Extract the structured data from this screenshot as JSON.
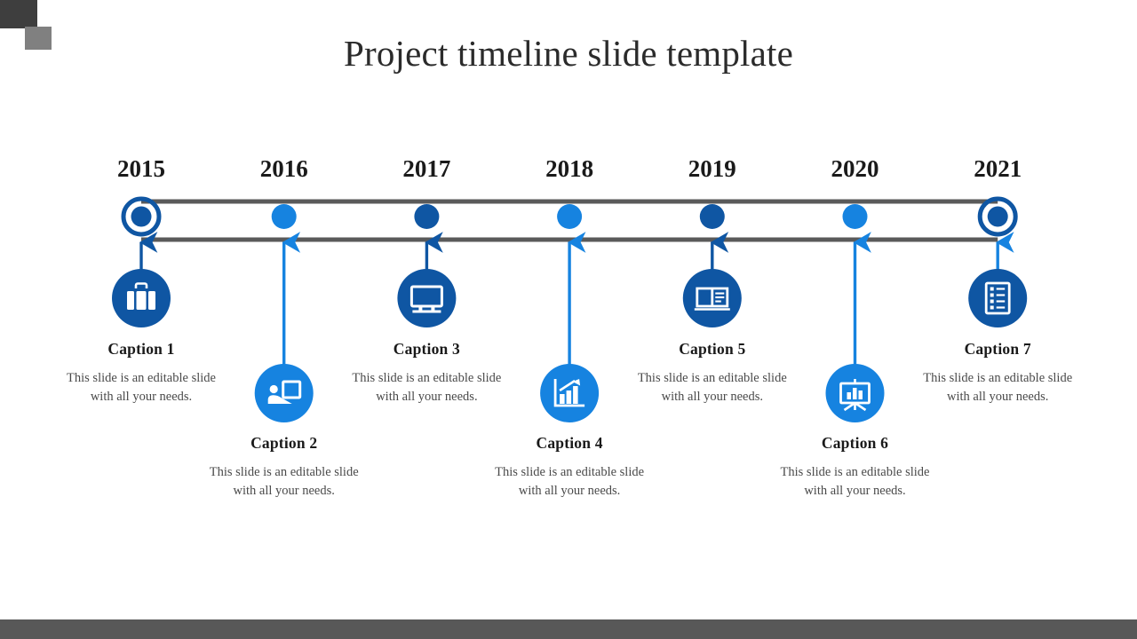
{
  "slide": {
    "title": "Project timeline slide template",
    "background_color": "#ffffff",
    "footer_color": "#585858",
    "corner_square_dark_color": "#3e3e3e",
    "corner_square_mid_color": "#808080"
  },
  "palette": {
    "dark_blue": "#0f56a3",
    "light_blue": "#1683e0",
    "rail_gray": "#5a5a5a",
    "title_color": "#2b2b2b",
    "caption_title_color": "#1a1a1a",
    "caption_body_color": "#4a4a4a"
  },
  "timeline": {
    "rail_style": "double-horizontal-line",
    "milestones": [
      {
        "year": "2015",
        "marker_style": "ring",
        "marker_color": "#0f56a3",
        "icon": "briefcase-icon",
        "icon_circle_color": "#0f56a3",
        "connector_color": "#0f56a3",
        "row": "upper",
        "caption_title": "Caption 1",
        "caption_body": "This slide is an editable slide with all your needs."
      },
      {
        "year": "2016",
        "marker_style": "solid",
        "marker_color": "#1683e0",
        "icon": "presenter-board-icon",
        "icon_circle_color": "#1683e0",
        "connector_color": "#1683e0",
        "row": "lower",
        "caption_title": "Caption 2",
        "caption_body": "This slide is an editable slide with all your needs."
      },
      {
        "year": "2017",
        "marker_style": "solid",
        "marker_color": "#0f56a3",
        "icon": "monitor-icon",
        "icon_circle_color": "#0f56a3",
        "connector_color": "#0f56a3",
        "row": "upper",
        "caption_title": "Caption 3",
        "caption_body": "This slide is an editable slide with all your needs."
      },
      {
        "year": "2018",
        "marker_style": "solid",
        "marker_color": "#1683e0",
        "icon": "bar-chart-growth-icon",
        "icon_circle_color": "#1683e0",
        "connector_color": "#1683e0",
        "row": "lower",
        "caption_title": "Caption 4",
        "caption_body": "This slide is an editable slide with all your needs."
      },
      {
        "year": "2019",
        "marker_style": "solid",
        "marker_color": "#0f56a3",
        "icon": "open-book-icon",
        "icon_circle_color": "#0f56a3",
        "connector_color": "#0f56a3",
        "row": "upper",
        "caption_title": "Caption 5",
        "caption_body": "This slide is an editable slide with all your needs."
      },
      {
        "year": "2020",
        "marker_style": "solid",
        "marker_color": "#1683e0",
        "icon": "presentation-easel-icon",
        "icon_circle_color": "#1683e0",
        "connector_color": "#1683e0",
        "row": "lower",
        "caption_title": "Caption 6",
        "caption_body": "This slide is an editable slide with all your needs."
      },
      {
        "year": "2021",
        "marker_style": "ring",
        "marker_color": "#0f56a3",
        "icon": "checklist-document-icon",
        "icon_circle_color": "#0f56a3",
        "connector_color": "#1683e0",
        "row": "upper",
        "caption_title": "Caption 7",
        "caption_body": "This slide is an editable slide with all your needs."
      }
    ]
  }
}
